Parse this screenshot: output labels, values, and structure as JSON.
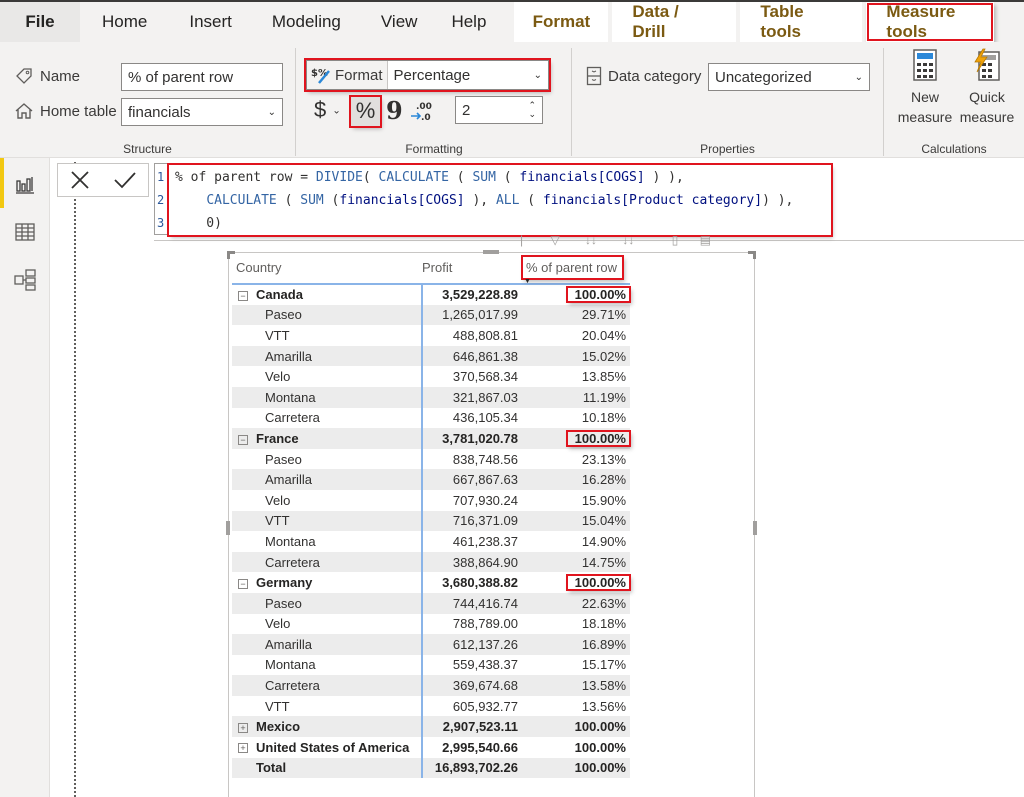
{
  "menu": {
    "tabs": [
      {
        "label": "File"
      },
      {
        "label": "Home"
      },
      {
        "label": "Insert"
      },
      {
        "label": "Modeling"
      },
      {
        "label": "View"
      },
      {
        "label": "Help"
      },
      {
        "label": "Format"
      },
      {
        "label": "Data / Drill"
      },
      {
        "label": "Table tools"
      },
      {
        "label": "Measure tools"
      }
    ],
    "active_tab": "Measure tools"
  },
  "ribbon": {
    "structure": {
      "group_label": "Structure",
      "name_label": "Name",
      "name_value": "% of parent row",
      "home_table_label": "Home table",
      "home_table_value": "financials"
    },
    "formatting": {
      "group_label": "Formatting",
      "format_label": "Format",
      "format_value": "Percentage",
      "currency_symbol": "$",
      "percent_symbol": "%",
      "comma_symbol": "9",
      "decimals_value": "2"
    },
    "properties": {
      "group_label": "Properties",
      "data_category_label": "Data category",
      "data_category_value": "Uncategorized"
    },
    "calculations": {
      "group_label": "Calculations",
      "new_measure_line1": "New",
      "new_measure_line2": "measure",
      "quick_measure_line1": "Quick",
      "quick_measure_line2": "measure"
    }
  },
  "formula_bar": {
    "line_numbers": [
      "1",
      "2",
      "3"
    ],
    "lines": [
      "% of parent row = DIVIDE( CALCULATE ( SUM ( financials[COGS] ) ),",
      "    CALCULATE ( SUM (financials[COGS] ), ALL ( financials[Product category]) ),",
      "    0)"
    ]
  },
  "matrix": {
    "headers": [
      "Country",
      "Profit",
      "% of parent row"
    ],
    "rows": [
      {
        "label": "Canada",
        "profit": "3,529,228.89",
        "pct": "100.00%",
        "level": 0,
        "expanded": true,
        "highlight": true
      },
      {
        "label": "Paseo",
        "profit": "1,265,017.99",
        "pct": "29.71%",
        "level": 1
      },
      {
        "label": "VTT",
        "profit": "488,808.81",
        "pct": "20.04%",
        "level": 1
      },
      {
        "label": "Amarilla",
        "profit": "646,861.38",
        "pct": "15.02%",
        "level": 1
      },
      {
        "label": "Velo",
        "profit": "370,568.34",
        "pct": "13.85%",
        "level": 1
      },
      {
        "label": "Montana",
        "profit": "321,867.03",
        "pct": "11.19%",
        "level": 1
      },
      {
        "label": "Carretera",
        "profit": "436,105.34",
        "pct": "10.18%",
        "level": 1
      },
      {
        "label": "France",
        "profit": "3,781,020.78",
        "pct": "100.00%",
        "level": 0,
        "expanded": true,
        "highlight": true
      },
      {
        "label": "Paseo",
        "profit": "838,748.56",
        "pct": "23.13%",
        "level": 1
      },
      {
        "label": "Amarilla",
        "profit": "667,867.63",
        "pct": "16.28%",
        "level": 1
      },
      {
        "label": "Velo",
        "profit": "707,930.24",
        "pct": "15.90%",
        "level": 1
      },
      {
        "label": "VTT",
        "profit": "716,371.09",
        "pct": "15.04%",
        "level": 1
      },
      {
        "label": "Montana",
        "profit": "461,238.37",
        "pct": "14.90%",
        "level": 1
      },
      {
        "label": "Carretera",
        "profit": "388,864.90",
        "pct": "14.75%",
        "level": 1
      },
      {
        "label": "Germany",
        "profit": "3,680,388.82",
        "pct": "100.00%",
        "level": 0,
        "expanded": true,
        "highlight": true
      },
      {
        "label": "Paseo",
        "profit": "744,416.74",
        "pct": "22.63%",
        "level": 1
      },
      {
        "label": "Velo",
        "profit": "788,789.00",
        "pct": "18.18%",
        "level": 1
      },
      {
        "label": "Amarilla",
        "profit": "612,137.26",
        "pct": "16.89%",
        "level": 1
      },
      {
        "label": "Montana",
        "profit": "559,438.37",
        "pct": "15.17%",
        "level": 1
      },
      {
        "label": "Carretera",
        "profit": "369,674.68",
        "pct": "13.58%",
        "level": 1
      },
      {
        "label": "VTT",
        "profit": "605,932.77",
        "pct": "13.56%",
        "level": 1
      },
      {
        "label": "Mexico",
        "profit": "2,907,523.11",
        "pct": "100.00%",
        "level": 0,
        "expanded": false
      },
      {
        "label": "United States of America",
        "profit": "2,995,540.66",
        "pct": "100.00%",
        "level": 0,
        "expanded": false
      },
      {
        "label": "Total",
        "profit": "16,893,702.26",
        "pct": "100.00%",
        "level": 0,
        "total": true
      }
    ]
  },
  "colors": {
    "highlight_red": "#e0141e",
    "context_tab_text": "#7b5a12",
    "report_accent": "#f2c811",
    "column_separator": "#8ab4e8"
  }
}
